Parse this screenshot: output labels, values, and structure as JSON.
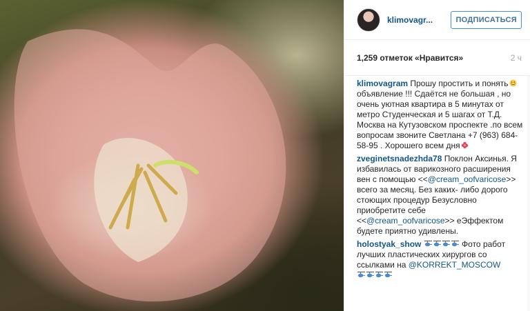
{
  "header": {
    "username": "klimovagr...",
    "follow_label": "ПОДПИСАТЬСЯ"
  },
  "stats": {
    "likes": "1,259 отметок «Нравится»",
    "time": "2 ч"
  },
  "comments": [
    {
      "user": "klimovagram",
      "text1": " Прошу простить и понять",
      "emoji1": "grinning-sweat-icon",
      "text2": " объявление !!! Сдаётся не большая , но очень уютная квартира в 5 минутах от метро Студенческая и 5 шагах от Т.Д. Москва на Кутузовском проспекте .по всем вопросам звоните Светлана +7 (963) 684-58-95 . Хорошего всем дня",
      "emoji2": "hibiscus-icon"
    },
    {
      "user": "zveginetsnadezhda78",
      "text1": " Поклон Аксинья. Я избавилась от варикозного расширения вен с помощью <<",
      "mention1": "@cream_oofvaricose",
      "text2": ">> всего за месяц. Без каких- либо дорого стоющих процедур Безусловно приобретите себе <<",
      "mention2": "@cream_oofvaricose",
      "text3": ">> еЭффектом будете приятно удивлены."
    },
    {
      "user": "holostyak_show",
      "emoji": "helicopter-icon",
      "text1": " Фото работ лучших пластических хирургов со ссылками на ",
      "mention1": "@KORREKT_MOSCOW"
    }
  ],
  "colors": {
    "link": "#125688",
    "follow_border": "#4090db",
    "follow_text": "#3f729b",
    "muted": "#a5a7aa"
  }
}
